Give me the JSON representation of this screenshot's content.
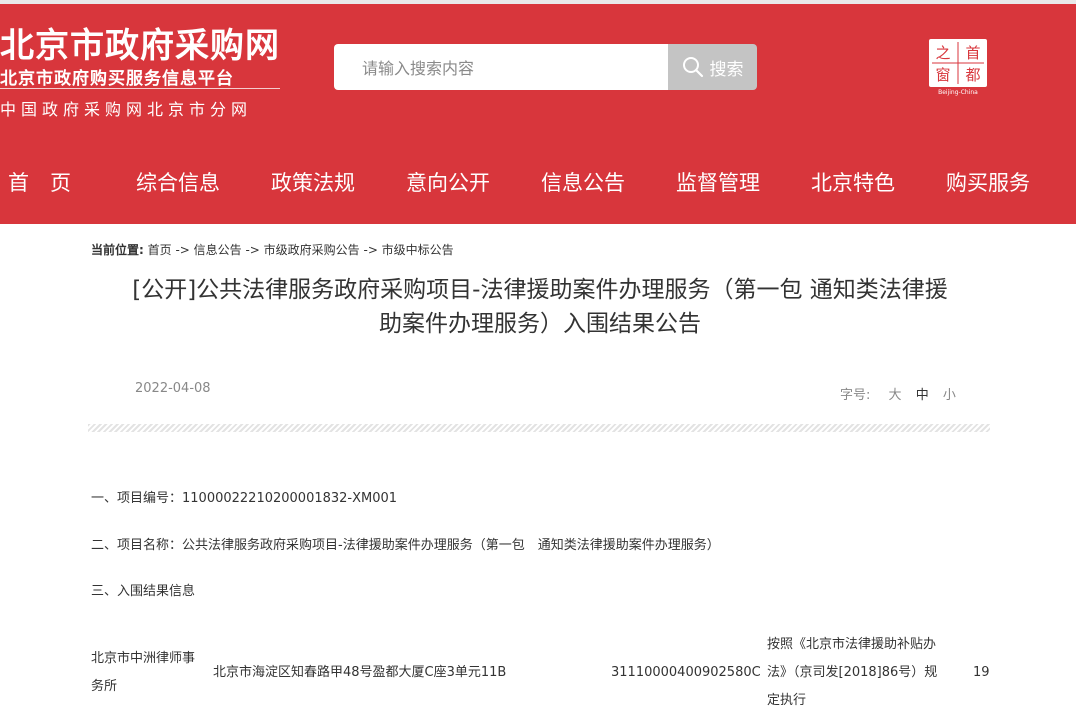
{
  "header": {
    "site_title": "北京市政府采购网",
    "subtitle_1": "北京市政府购买服务信息平台",
    "subtitle_2": "中国政府采购网北京市分网",
    "emblem_chars": [
      "之",
      "首",
      "都",
      "窗"
    ],
    "emblem_caption": "Beijing-China",
    "colors": {
      "brand_red": "#d8363c",
      "search_button": "#c4c4c4"
    }
  },
  "search": {
    "placeholder": "请输入搜索内容",
    "button_label": "搜索",
    "icon": "search-icon"
  },
  "nav": {
    "items": [
      "首　页",
      "综合信息",
      "政策法规",
      "意向公开",
      "信息公告",
      "监督管理",
      "北京特色",
      "购买服务"
    ]
  },
  "breadcrumb": {
    "label": "当前位置:",
    "path": "首页 -> 信息公告 -> 市级政府采购公告 -> 市级中标公告"
  },
  "article": {
    "title_line1": "[公开]公共法律服务政府采购项目-法律援助案件办理服务（第一包 通知类法律援",
    "title_line2": "助案件办理服务）入围结果公告",
    "date": "2022-04-08",
    "font_size": {
      "label": "字号:",
      "large": "大",
      "medium": "中",
      "small": "小"
    }
  },
  "content": {
    "item1": "一、项目编号：11000022210200001832-XM001",
    "item2": "二、项目名称：公共法律服务政府采购项目-法律援助案件办理服务（第一包　通知类法律援助案件办理服务）",
    "item3": "三、入围结果信息",
    "row1": {
      "name_line1": "北京市中洲律师事",
      "name_line2": "务所",
      "address": "北京市海淀区知春路甲48号盈都大厦C座3单元11B",
      "license": "31110000400902580C",
      "price_line1": "按照《北京市法律援助补贴办",
      "price_line2": "法》（京司发[2018]86号）规",
      "price_line3": "定执行",
      "count": "19"
    }
  }
}
